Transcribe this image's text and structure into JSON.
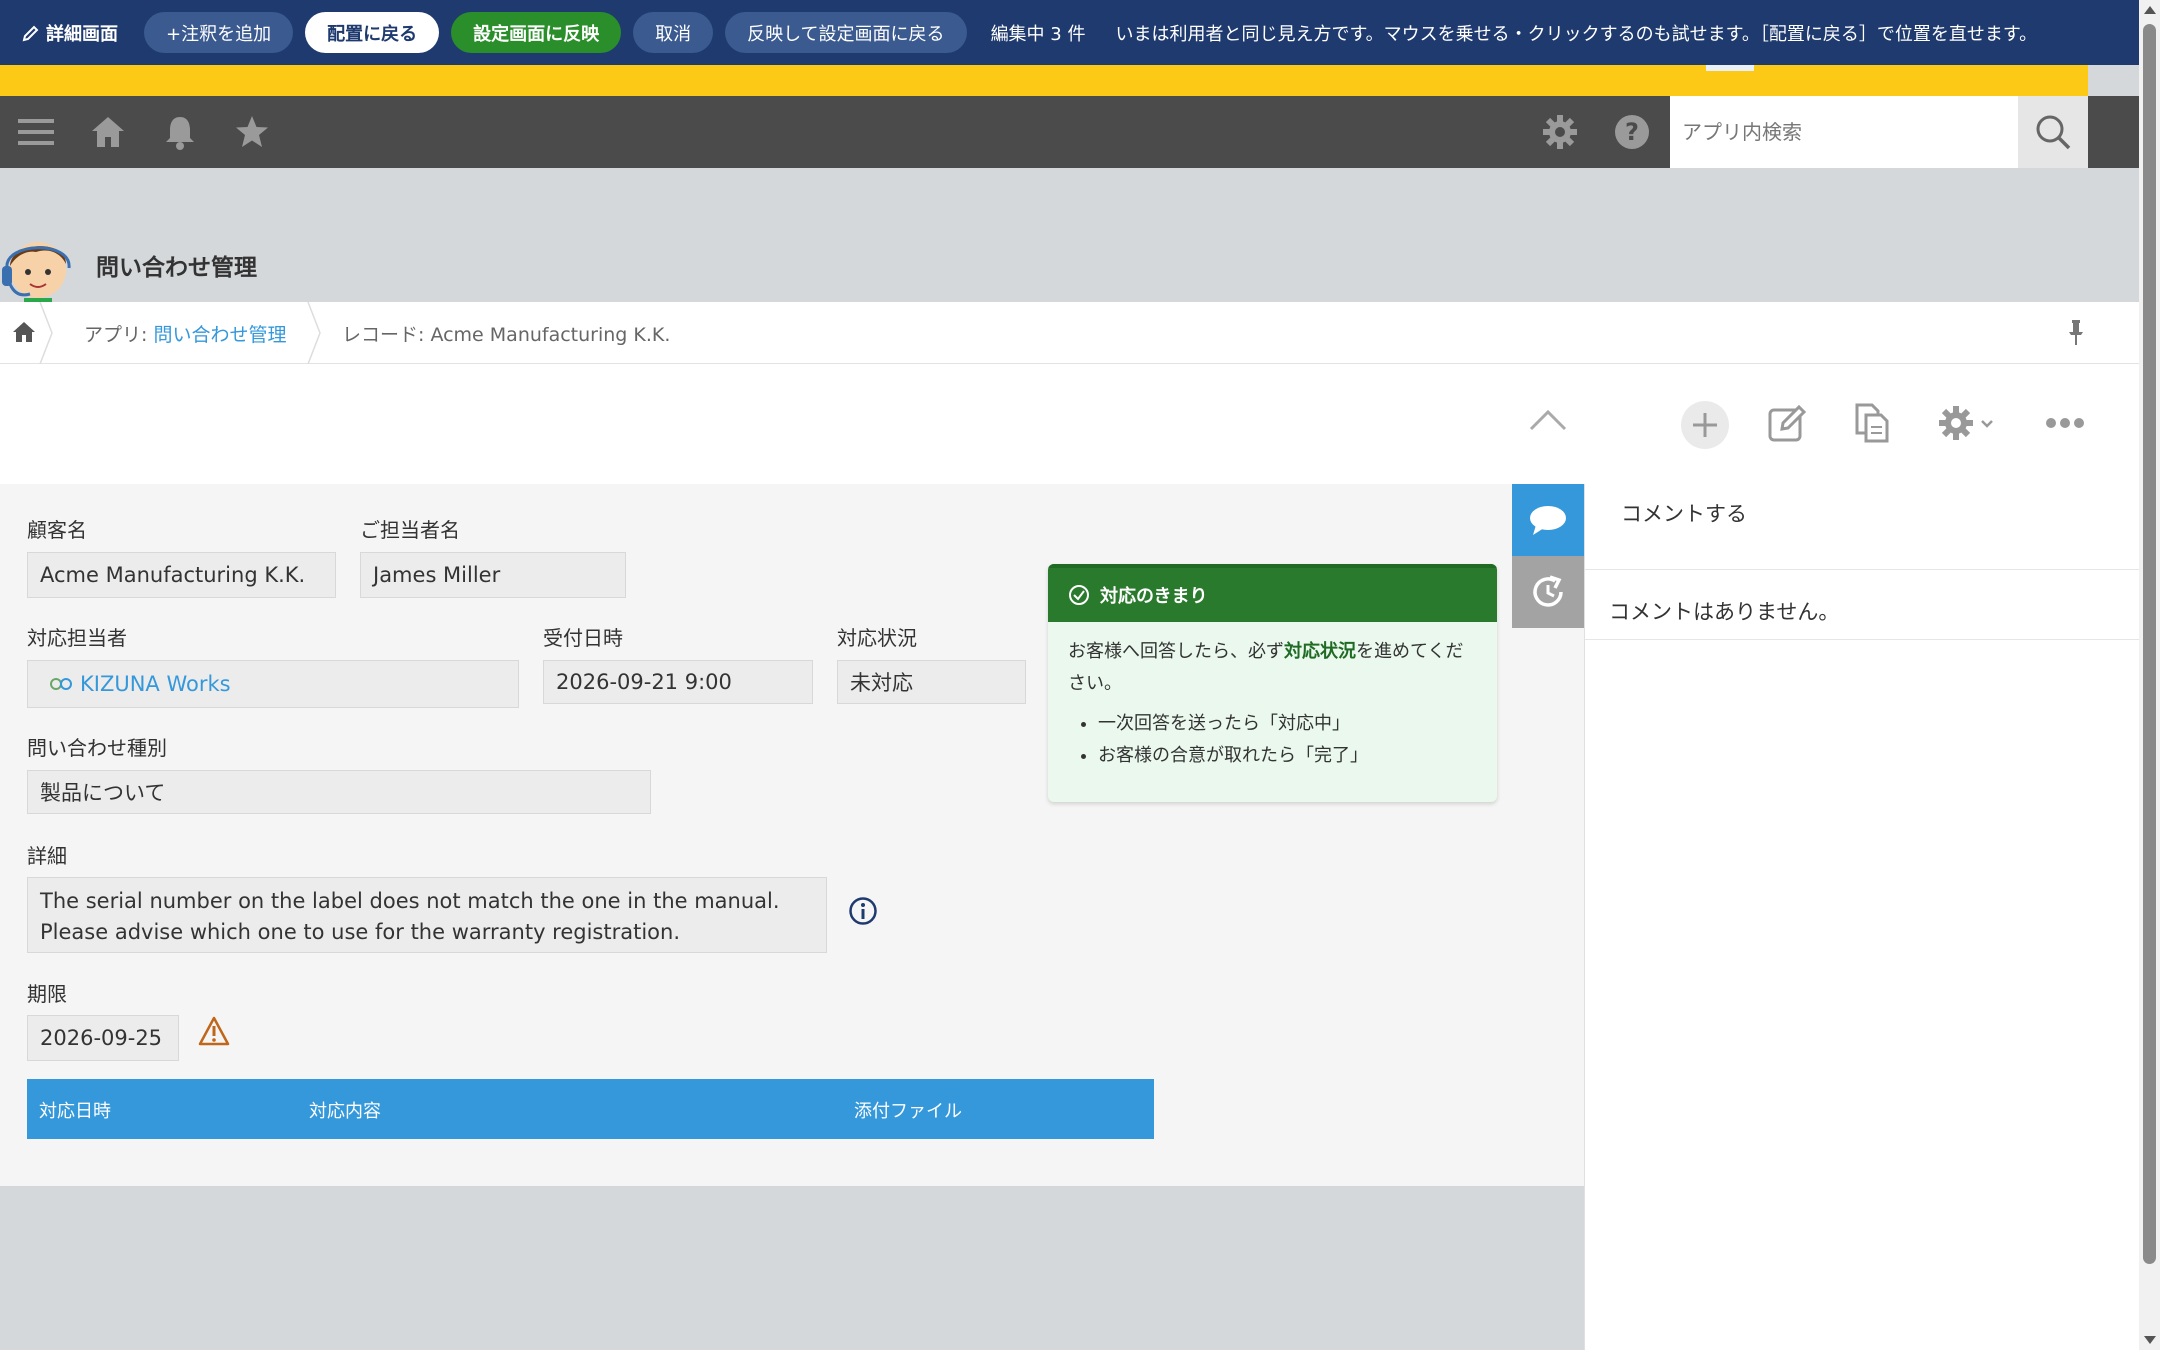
{
  "editbar": {
    "mode_label": "詳細画面",
    "add_note": "+注釈を追加",
    "restore_layout": "配置に戻る",
    "apply_settings": "設定画面に反映",
    "cancel": "取消",
    "apply_and_back": "反映して設定画面に戻る",
    "editing_count": "編集中 3 件",
    "hint": "いまは利用者と同じ見え方です。マウスを乗せる・クリックするのも試せます。［配置に戻る］で位置を直せます。"
  },
  "header": {
    "search_placeholder": "アプリ内検索"
  },
  "app": {
    "title": "問い合わせ管理"
  },
  "breadcrumb": {
    "app_prefix": "アプリ: ",
    "app_link": "問い合わせ管理",
    "record": "レコード: Acme Manufacturing K.K."
  },
  "record": {
    "customer_label": "顧客名",
    "customer_value": "Acme Manufacturing K.K.",
    "contact_label": "ご担当者名",
    "contact_value": "James Miller",
    "assignee_label": "対応担当者",
    "assignee_value": "KIZUNA Works",
    "received_label": "受付日時",
    "received_value": "2026-09-21 9:00",
    "status_label": "対応状況",
    "status_value": "未対応",
    "type_label": "問い合わせ種別",
    "type_value": "製品について",
    "detail_label": "詳細",
    "detail_line1": "The serial number on the label does not match the one in the manual.",
    "detail_line2": "Please advise which one to use for the warranty registration.",
    "deadline_label": "期限",
    "deadline_value": "2026-09-25"
  },
  "note": {
    "title": "対応のきまり",
    "body_pre": "お客様へ回答したら、必ず",
    "body_bold": "対応状況",
    "body_post": "を進めてください。",
    "items": [
      "一次回答を送ったら「対応中」",
      "お客様の合意が取れたら「完了」"
    ]
  },
  "subtable": {
    "col1": "対応日時",
    "col2": "対応内容",
    "col3": "添付ファイル"
  },
  "comments": {
    "input_placeholder": "コメントする",
    "empty": "コメントはありません。"
  },
  "colors": {
    "editbar_bg": "#1f3a6e",
    "accent_yellow": "#fbc916",
    "header_gray": "#4b4b4b",
    "link_blue": "#3498db",
    "note_green": "#2a7a2e",
    "apply_green": "#2a8f2a"
  }
}
